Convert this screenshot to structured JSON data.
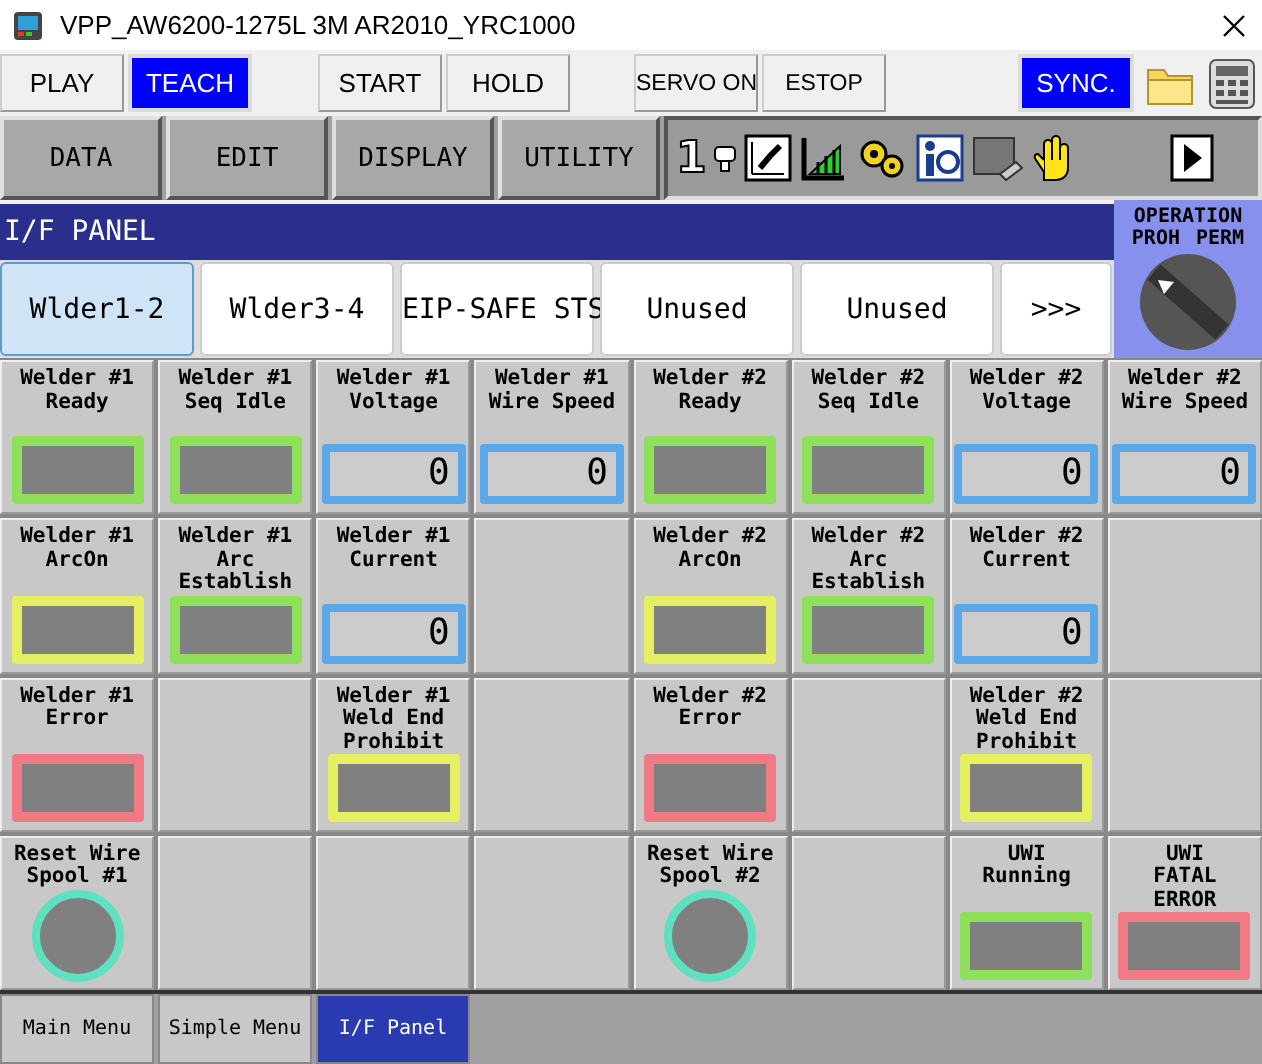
{
  "window": {
    "title": "VPP_AW6200-1275L 3M AR2010_YRC1000"
  },
  "button_groups": [
    [
      {
        "label": "PLAY",
        "selected": false
      },
      {
        "label": "TEACH",
        "selected": true
      }
    ],
    [
      {
        "label": "START",
        "selected": false
      },
      {
        "label": "HOLD",
        "selected": false
      }
    ],
    [
      {
        "label": "SERVO ON",
        "selected": false
      },
      {
        "label": "ESTOP",
        "selected": false
      }
    ],
    [
      {
        "label": "SYNC.",
        "selected": true
      }
    ]
  ],
  "menu": [
    "DATA",
    "EDIT",
    "DISPLAY",
    "UTILITY"
  ],
  "status": {
    "robot_number": "1"
  },
  "panel": {
    "title": "I/F PANEL",
    "tabs": [
      {
        "label": "Wlder1-2",
        "selected": true
      },
      {
        "label": "Wlder3-4",
        "selected": false
      },
      {
        "label": "EIP-SAFE STS",
        "selected": false
      },
      {
        "label": "Unused",
        "selected": false
      },
      {
        "label": "Unused",
        "selected": false
      },
      {
        "label": ">>>",
        "selected": false
      }
    ],
    "operation_key": {
      "title": "OPERATION",
      "left": "PROH",
      "right": "PERM"
    }
  },
  "grid": {
    "rows": [
      [
        {
          "kind": "lamp",
          "label": "Welder #1\nReady",
          "color": "#8ee05a"
        },
        {
          "kind": "lamp",
          "label": "Welder #1\nSeq Idle",
          "color": "#8ee05a"
        },
        {
          "kind": "value",
          "label": "Welder #1\nVoltage",
          "value": "0"
        },
        {
          "kind": "value",
          "label": "Welder #1\nWire Speed",
          "value": "0"
        },
        {
          "kind": "lamp",
          "label": "Welder #2\nReady",
          "color": "#8ee05a"
        },
        {
          "kind": "lamp",
          "label": "Welder #2\nSeq Idle",
          "color": "#8ee05a"
        },
        {
          "kind": "value",
          "label": "Welder #2\nVoltage",
          "value": "0"
        },
        {
          "kind": "value",
          "label": "Welder #2\nWire Speed",
          "value": "0"
        }
      ],
      [
        {
          "kind": "lamp",
          "label": "Welder #1\nArcOn",
          "color": "#e4f062"
        },
        {
          "kind": "lamp",
          "label": "Welder #1\nArc\nEstablish",
          "color": "#8ee05a"
        },
        {
          "kind": "value",
          "label": "Welder #1\nCurrent",
          "value": "0"
        },
        {
          "kind": "empty"
        },
        {
          "kind": "lamp",
          "label": "Welder #2\nArcOn",
          "color": "#e4f062"
        },
        {
          "kind": "lamp",
          "label": "Welder #2\nArc\nEstablish",
          "color": "#8ee05a"
        },
        {
          "kind": "value",
          "label": "Welder #2\nCurrent",
          "value": "0"
        },
        {
          "kind": "empty"
        }
      ],
      [
        {
          "kind": "lamp",
          "label": "Welder #1\nError",
          "color": "#f07a86"
        },
        {
          "kind": "empty"
        },
        {
          "kind": "lamp",
          "label": "Welder #1\nWeld End\nProhibit",
          "color": "#e4f062"
        },
        {
          "kind": "empty"
        },
        {
          "kind": "lamp",
          "label": "Welder #2\nError",
          "color": "#f07a86"
        },
        {
          "kind": "empty"
        },
        {
          "kind": "lamp",
          "label": "Welder #2\nWeld End\nProhibit",
          "color": "#e4f062"
        },
        {
          "kind": "empty"
        }
      ],
      [
        {
          "kind": "button",
          "label": "Reset Wire\nSpool #1"
        },
        {
          "kind": "empty"
        },
        {
          "kind": "empty"
        },
        {
          "kind": "empty"
        },
        {
          "kind": "button",
          "label": "Reset Wire\nSpool #2"
        },
        {
          "kind": "empty"
        },
        {
          "kind": "lamp",
          "label": "UWI\nRunning",
          "color": "#8ee05a"
        },
        {
          "kind": "lamp",
          "label": "UWI\nFATAL\nERROR",
          "color": "#f07a86"
        }
      ]
    ]
  },
  "bottom_tabs": [
    {
      "label": "Main Menu",
      "selected": false
    },
    {
      "label": "Simple Menu",
      "selected": false
    },
    {
      "label": "I/F Panel",
      "selected": true
    }
  ]
}
